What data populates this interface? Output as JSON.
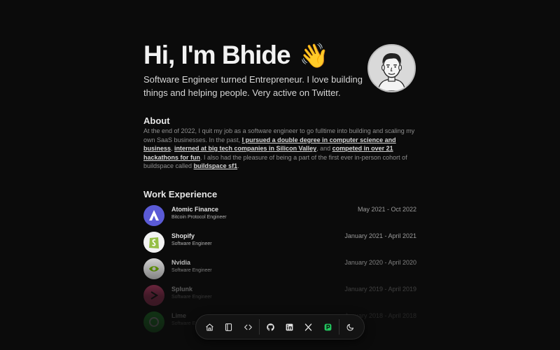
{
  "hero": {
    "greeting": "Hi, I'm Bhide",
    "wave": "👋",
    "subtitle": "Software Engineer turned Entrepreneur. I love building things and helping people. Very active on Twitter."
  },
  "about": {
    "title": "About",
    "text_1": "At the end of 2022, I quit my job as a software engineer to go fulltime into building and scaling my own SaaS businesses. In the past, ",
    "link_1": "I pursued a double degree in computer science and business",
    "text_2": ", ",
    "link_2": "interned at big tech companies in Silicon Valley",
    "text_3": ", and ",
    "link_3": "competed in over 21 hackathons for fun",
    "text_4": ". I also had the pleasure of being a part of the first ever in-person cohort of buildspace called ",
    "link_4": "buildspace sf1",
    "text_5": "."
  },
  "work": {
    "title": "Work Experience",
    "items": [
      {
        "company": "Atomic Finance",
        "role": "Bitcoin Protocol Engineer",
        "dates": "May 2021 - Oct 2022",
        "logo_color": "#5b5bd6"
      },
      {
        "company": "Shopify",
        "role": "Software Engineer",
        "dates": "January 2021 - April 2021",
        "logo_color": "#95bf47"
      },
      {
        "company": "Nvidia",
        "role": "Software Engineer",
        "dates": "January 2020 - April 2020",
        "logo_color": "#e8e8e8"
      },
      {
        "company": "Splunk",
        "role": "Software Engineer",
        "dates": "January 2019 - April 2019",
        "logo_color": "#e0457b"
      },
      {
        "company": "Lime",
        "role": "Software Engineer",
        "dates": "January 2018 - April 2018",
        "logo_color": "#2bd43d"
      }
    ]
  },
  "dock": {
    "items": [
      "home-icon",
      "notebook-icon",
      "code-icon",
      "github-icon",
      "linkedin-icon",
      "x-icon",
      "gumroad-icon",
      "moon-icon"
    ]
  },
  "colors": {
    "background": "#0b0b0b",
    "link": "#d8d8d8"
  }
}
